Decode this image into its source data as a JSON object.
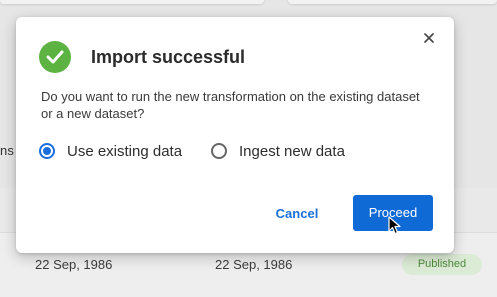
{
  "background": {
    "partial_text": "ns",
    "rows": [
      {
        "date1": "22 Sep, 1986",
        "date2": "22 Sep, 1986",
        "status": "Published"
      }
    ]
  },
  "dialog": {
    "title": "Import successful",
    "message": "Do you want to run the new transformation on the existing dataset or a new dataset?",
    "options": [
      {
        "label": "Use existing data",
        "selected": true
      },
      {
        "label": "Ingest new data",
        "selected": false
      }
    ],
    "cancel_label": "Cancel",
    "proceed_label": "Proceed",
    "icons": {
      "success": "check-circle-icon",
      "close": "close-icon"
    }
  },
  "colors": {
    "accent": "#1a6fdc",
    "primary_button": "#0f6ad6",
    "success": "#5cb341",
    "badge_bg": "#dcebd5",
    "badge_text": "#4d8a3c"
  }
}
